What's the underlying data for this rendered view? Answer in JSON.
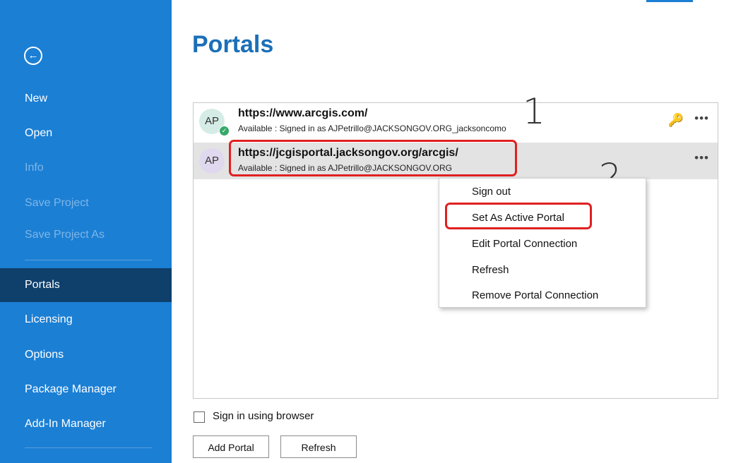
{
  "sidebar": {
    "back_icon": "back-arrow-icon",
    "items": [
      {
        "label": "New",
        "state": "enabled"
      },
      {
        "label": "Open",
        "state": "enabled"
      },
      {
        "label": "Info",
        "state": "disabled"
      },
      {
        "label": "Save Project",
        "state": "disabled"
      },
      {
        "label": "Save Project As",
        "state": "disabled"
      },
      {
        "label": "Portals",
        "state": "active"
      },
      {
        "label": "Licensing",
        "state": "enabled"
      },
      {
        "label": "Options",
        "state": "enabled"
      },
      {
        "label": "Package Manager",
        "state": "enabled"
      },
      {
        "label": "Add-In Manager",
        "state": "enabled"
      }
    ]
  },
  "page": {
    "title": "Portals"
  },
  "portals": [
    {
      "initials": "AP",
      "url": "https://www.arcgis.com/",
      "status": "Available : Signed in as AJPetrillo@JACKSONGOV.ORG_jacksoncomo",
      "active": true
    },
    {
      "initials": "AP",
      "url": "https://jcgisportal.jacksongov.org/arcgis/",
      "status": "Available : Signed in as AJPetrillo@JACKSONGOV.ORG",
      "active": false
    }
  ],
  "context_menu": {
    "items": [
      "Sign out",
      "Set As Active Portal",
      "Edit Portal Connection",
      "Refresh",
      "Remove Portal Connection"
    ]
  },
  "annotations": {
    "step1": "1",
    "step2": "2"
  },
  "footer": {
    "checkbox_label": "Sign in using browser",
    "checkbox_checked": false,
    "add_portal_label": "Add Portal",
    "refresh_label": "Refresh"
  },
  "colors": {
    "sidebar_bg": "#1b7fd4",
    "sidebar_active": "#0f3f6b",
    "title": "#1b6fb8",
    "annotation": "#e02020"
  }
}
